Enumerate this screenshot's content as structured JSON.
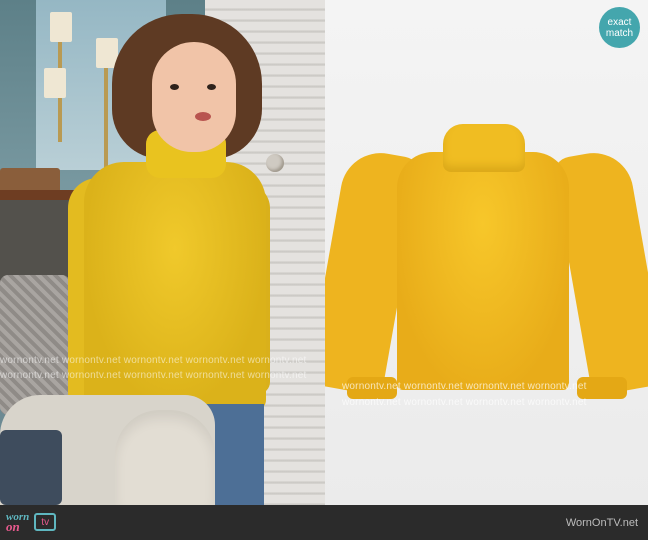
{
  "badge": {
    "line1": "exact",
    "line2": "match"
  },
  "watermarks": {
    "left_row1": "wornontv.net  wornontv.net  wornontv.net  wornontv.net  wornontv.net",
    "left_row2": "wornontv.net  wornontv.net  wornontv.net  wornontv.net  wornontv.net",
    "right_row1": "wornontv.net  wornontv.net  wornontv.net  wornontv.net",
    "right_row2": "wornontv.net  wornontv.net  wornontv.net  wornontv.net"
  },
  "footer": {
    "logo_worn": "worn",
    "logo_on": "on",
    "logo_tv": "tv",
    "site_credit": "WornOnTV.net"
  },
  "colors": {
    "badge": "#44a6ad",
    "sweater_yellow": "#f0c92b",
    "footer_bg": "#2b2b2b",
    "logo_teal": "#5fb7c0",
    "logo_pink": "#e85a8e"
  }
}
